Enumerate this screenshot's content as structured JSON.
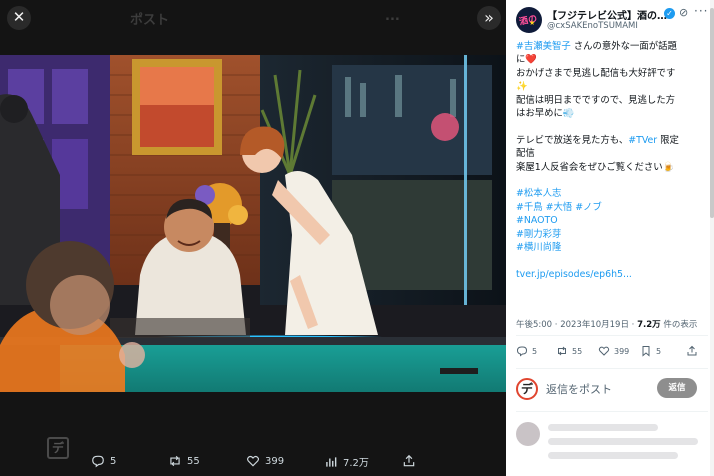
{
  "viewer": {
    "ghost_title": "ポスト",
    "ghost_menu": "...",
    "close_glyph": "✕",
    "expand_glyph": "»",
    "actions": [
      {
        "name": "reply",
        "count": "5"
      },
      {
        "name": "repost",
        "count": "55"
      },
      {
        "name": "like",
        "count": "399"
      },
      {
        "name": "views",
        "count": "7.2万"
      },
      {
        "name": "share",
        "count": ""
      }
    ]
  },
  "account": {
    "name": "【フジテレビ公式】酒の…",
    "handle": "@cxSAKEnoTSUMAMI",
    "more_glyph": "···"
  },
  "tweet": {
    "lines": [
      [
        {
          "t": "#吉瀬美智子",
          "h": true
        },
        {
          "t": " さんの意外な一面が話題",
          "h": false
        }
      ],
      [
        {
          "t": "に❤️",
          "h": false
        }
      ],
      [
        {
          "t": "おかげさまで見逃し配信も大好評です",
          "h": false
        }
      ],
      [
        {
          "t": "✨",
          "h": false
        }
      ],
      [
        {
          "t": "配信は明日まで",
          "h": false
        },
        {
          "t": "ですので、見逃した方",
          "h": false
        }
      ],
      [
        {
          "t": "はお早めに💨",
          "h": false
        }
      ],
      [],
      [
        {
          "t": "テレビで放送を見た方も、",
          "h": false
        },
        {
          "t": "#TVer",
          "h": true
        },
        {
          "t": " 限定",
          "h": false
        }
      ],
      [
        {
          "t": "配信",
          "h": false
        }
      ],
      [
        {
          "t": "楽屋1人反省会をぜひご覧ください🍺",
          "h": false
        }
      ],
      [],
      [
        {
          "t": "#松本人志",
          "h": true
        }
      ],
      [
        {
          "t": "#千鳥",
          "h": true
        },
        {
          "t": " ",
          "h": false
        },
        {
          "t": "#大悟",
          "h": true
        },
        {
          "t": " ",
          "h": false
        },
        {
          "t": "#ノブ",
          "h": true
        }
      ],
      [
        {
          "t": "#NAOTO",
          "h": true
        }
      ],
      [
        {
          "t": "#剛力彩芽",
          "h": true
        }
      ],
      [
        {
          "t": "#横川尚隆",
          "h": true
        }
      ],
      [],
      [
        {
          "t": "tver.jp/episodes/ep6h5...",
          "h": true
        }
      ]
    ],
    "time": "午後5:00 · 2023年10月19日 · ",
    "views_value": "7.2万",
    "views_label": " 件の表示"
  },
  "tweet_actions": [
    {
      "name": "reply",
      "count": "5"
    },
    {
      "name": "repost",
      "count": "55"
    },
    {
      "name": "like",
      "count": "399"
    },
    {
      "name": "bookmark",
      "count": "5"
    },
    {
      "name": "share",
      "count": ""
    }
  ],
  "reply_box": {
    "avatar_glyph": "デ",
    "placeholder": "返信をポスト",
    "button": "返信"
  },
  "colors": {
    "accent": "#1d9bf0",
    "verified": "#1d9bf0",
    "reply_button": "#8e8e8e",
    "viewer_bg": "#141414"
  }
}
